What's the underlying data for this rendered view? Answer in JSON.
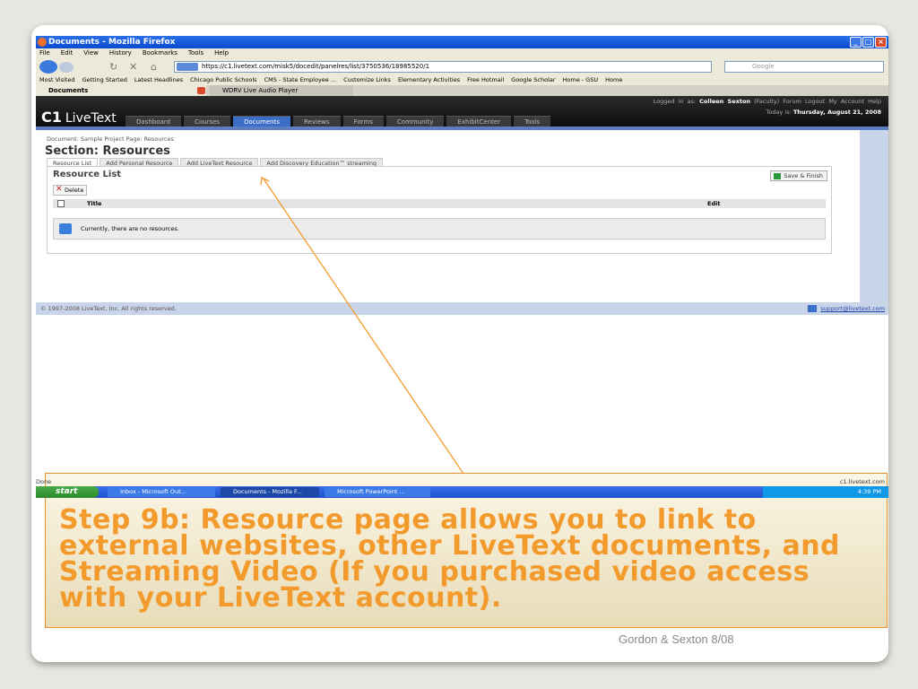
{
  "browser": {
    "window_title": "Documents - Mozilla Firefox",
    "menu": [
      "File",
      "Edit",
      "View",
      "History",
      "Bookmarks",
      "Tools",
      "Help"
    ],
    "url": "https://c1.livetext.com/misk5/docedit/panelres/list/3750536/18985520/1",
    "search_placeholder": "Google",
    "bookmarks": [
      "Most Visited",
      "Getting Started",
      "Latest Headlines",
      "Chicago Public Schools",
      "CMS - State Employee ...",
      "Customize Links",
      "Elementary Activities",
      "Free Hotmail",
      "Google Scholar",
      "Home - GSU",
      "Home"
    ],
    "tabs": [
      "Documents",
      "WDRV Live Audio Player"
    ],
    "status_left": "Done",
    "status_right": "c1.livetext.com"
  },
  "app": {
    "logo_c1": "C1",
    "logo_name": "LiveText",
    "logged_in_prefix": "Logged in as:",
    "user": "Colleen Sexton",
    "role": "(Faculty)",
    "top_links": [
      "Forum",
      "Logout",
      "My Account",
      "Help"
    ],
    "today_prefix": "Today is:",
    "today": "Thursday, August 21, 2008",
    "nav": [
      "Dashboard",
      "Courses",
      "Documents",
      "Reviews",
      "Forms",
      "Community",
      "ExhibitCenter",
      "Tools"
    ],
    "breadcrumb": "Document: Sample Project   Page: Resources",
    "section_title": "Section: Resources",
    "subtabs": [
      "Resource List",
      "Add Personal Resource",
      "Add LiveText Resource",
      "Add Discovery Education™ streaming"
    ],
    "panel_title": "Resource List",
    "save_label": "Save & Finish",
    "delete_label": "Delete",
    "col_title": "Title",
    "col_edit": "Edit",
    "empty_message": "Currently, there are no resources.",
    "copyright": "© 1997-2008 LiveText, Inc. All rights reserved.",
    "support": "support@livetext.com"
  },
  "taskbar": {
    "start": "start",
    "tasks": [
      "Inbox - Microsoft Out...",
      "Documents - Mozilla F...",
      "Microsoft PowerPoint ..."
    ],
    "clock": "4:39 PM"
  },
  "slide": {
    "caption": "Step 9b: Resource page allows you to link to external websites, other LiveText documents, and Streaming Video (If you purchased video access with your LiveText account).",
    "credit": "Gordon & Sexton 8/08"
  },
  "colors": {
    "accent": "#f39a2c",
    "app_blue": "#3a6ec8"
  }
}
